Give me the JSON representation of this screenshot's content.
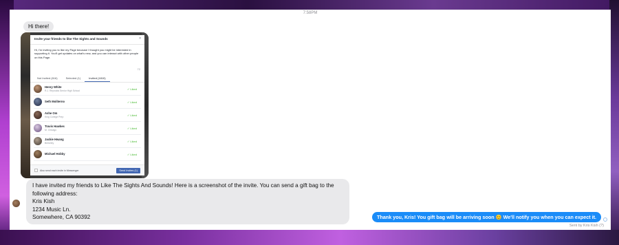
{
  "timestamp": "7:58PM",
  "messages": {
    "greeting": "Hi there!",
    "invite_text_line1": "I have invited my friends to Like The Sights And Sounds! Here is a screenshot of the invite. You can send a gift bag to the following address:",
    "invite_text_line2": "Kris Kish",
    "invite_text_line3": "1234 Music Ln.",
    "invite_text_line4": "Somewhere, CA 90392",
    "reply": "Thank you, Kris! You gift bag will be arriving soon 😊 We'll notify you when you can expect it.",
    "sent_by": "Sent by Kris Kish (?)"
  },
  "screenshot_dialog": {
    "title": "Invite your friends to like The Sights and Sounds",
    "close": "×",
    "message": "Hi, I'm inviting you to like my Page because I thought you might be interested in supporting it. You'll get updates on what's new, and you can interact with other people on this Page.",
    "char_count": "72",
    "tabs": [
      {
        "label": "Not Invited (616)"
      },
      {
        "label": "Selected (1)"
      },
      {
        "label": "Invited (1810)"
      }
    ],
    "rows": [
      {
        "name": "Henry White",
        "sub": "R.J. Reynolds Senior High School",
        "status": "✓ Liked"
      },
      {
        "name": "Seth Moliterno",
        "sub": "",
        "status": "✓ Liked"
      },
      {
        "name": "Ashe Om",
        "sub": "King College Prep",
        "status": "✓ Liked"
      },
      {
        "name": "Travis Hawkes",
        "sub": "M. Chicago",
        "status": "✓ Liked"
      },
      {
        "name": "Jackie Hwang",
        "sub": "Berkeley",
        "status": "✓ Liked"
      },
      {
        "name": "Michael Hobby",
        "sub": "",
        "status": "✓ Liked"
      }
    ],
    "footer_checkbox_label": "Also send each invite in Messenger",
    "send_button": "Send Invites (1)"
  },
  "colors": {
    "accent_blue": "#1a8cf8",
    "liked_green": "#42b72a",
    "facebook_blue": "#4267b2"
  }
}
